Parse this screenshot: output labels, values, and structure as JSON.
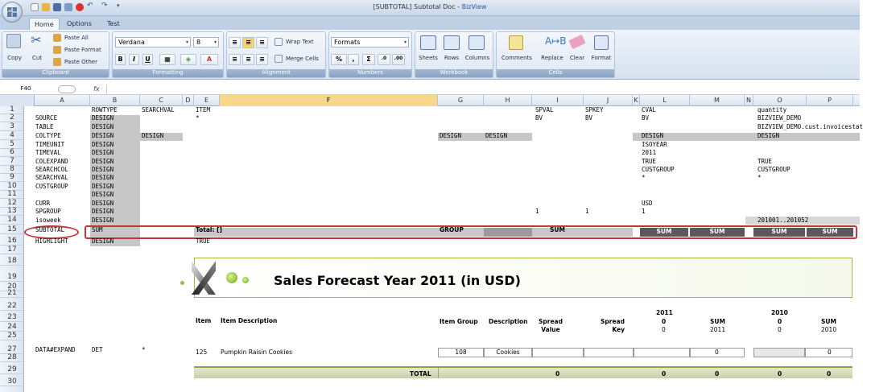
{
  "window": {
    "title_prefix": "[SUBTOTAL] Subtotal Doc - ",
    "app_name": "BizView"
  },
  "tabs": [
    {
      "label": "Home",
      "active": true
    },
    {
      "label": "Options"
    },
    {
      "label": "Test"
    }
  ],
  "ribbon": {
    "clipboard": {
      "label": "Clipboard",
      "copy": "Copy",
      "cut": "Cut",
      "paste_all": "Paste All",
      "paste_format": "Paste Format",
      "paste_other": "Paste Other"
    },
    "formatting": {
      "label": "Formatting",
      "font": "Verdana",
      "size": "8",
      "bold": "B",
      "italic": "I",
      "underline": "U"
    },
    "alignment": {
      "label": "Alignment",
      "wrap": "Wrap Text",
      "merge": "Merge Cells"
    },
    "numbers": {
      "label": "Numbers",
      "format": "Formats",
      "percent": "%",
      "comma": ",",
      "sum": "Σ"
    },
    "workbook": {
      "label": "Workbook",
      "sheets": "Sheets",
      "rows": "Rows",
      "columns": "Columns"
    },
    "cells": {
      "label": "Cells",
      "comments": "Comments",
      "replace": "Replace",
      "clear": "Clear",
      "format": "Format"
    }
  },
  "formula": {
    "namebox": "F40",
    "fx": "fx"
  },
  "columns": [
    "A",
    "B",
    "C",
    "D",
    "E",
    "F",
    "G",
    "H",
    "I",
    "J",
    "K",
    "L",
    "M",
    "N",
    "O",
    "P"
  ],
  "rows": [
    "1",
    "2",
    "3",
    "4",
    "5",
    "6",
    "7",
    "8",
    "9",
    "10",
    "11",
    "12",
    "13",
    "14",
    "15",
    "16",
    "17",
    "18",
    "19",
    "20",
    "21",
    "22",
    "23",
    "24",
    "25",
    "27",
    "28",
    "29",
    "30"
  ],
  "cells": {
    "b1": "ROWTYPE",
    "c1": "SEARCHVAL",
    "e1": "ITEM",
    "i1": "SPVAL",
    "j1": "SPKEY",
    "l1": "CVAL",
    "o1": "quantity",
    "a2": "SOURCE",
    "b2": "DESIGN",
    "e2": "*",
    "i2": "BV",
    "j2": "BV",
    "l2": "BV",
    "o2": "BIZVIEW_DEMO",
    "a3": "TABLE",
    "b3": "DESIGN",
    "o3": "BIZVIEW_DEMO.cust.invoicestat",
    "a4": "COLTYPE",
    "b4": "DESIGN",
    "c4": "DESIGN",
    "g4": "DESIGN",
    "h4": "DESIGN",
    "l4": "DESIGN",
    "o4": "DESIGN",
    "a5": "TIMEUNIT",
    "b5": "DESIGN",
    "l5": "ISOYEAR",
    "a6": "TIMEVAL",
    "b6": "DESIGN",
    "l6": "2011",
    "a7": "COLEXPAND",
    "b7": "DESIGN",
    "l7": "TRUE",
    "o7": "TRUE",
    "a8": "SEARCHCOL",
    "b8": "DESIGN",
    "l8": "CUSTGROUP",
    "o8": "CUSTGROUP",
    "a9": "SEARCHVAL",
    "b9": "DESIGN",
    "l9": "*",
    "o9": "*",
    "a10": "CUSTGROUP",
    "b10": "DESIGN",
    "b11": "DESIGN",
    "a12": "CURR",
    "b12": "DESIGN",
    "l12": "USD",
    "a13": "SPGROUP",
    "b13": "DESIGN",
    "i13": "1",
    "j13": "1",
    "l13": "1",
    "a14": "isoweek",
    "b14": "DESIGN",
    "o14": "201001..201052",
    "a15": "SUBTOTAL",
    "b15": "SUM",
    "e15": "Total: []",
    "g15": "GROUP",
    "i15": "SUM",
    "l15": "SUM",
    "m15": "SUM",
    "o15": "SUM",
    "p15": "SUM",
    "a16": "HIGHLIGHT",
    "b16": "DESIGN",
    "e16": "TRUE",
    "a27": "DATA#EXPAND",
    "b27": "DET",
    "c27": "*"
  },
  "report": {
    "title": "Sales Forecast Year 2011 (in USD)",
    "year_l": "2011",
    "year_o": "2010",
    "h_item": "Item",
    "h_desc": "Item Description",
    "h_group": "Item Group",
    "h_description": "Description",
    "h_spread_value": "Spread\nValue",
    "h_spread_key": "Spread\nKey",
    "h_l": "0",
    "h_l2": "0",
    "h_m": "SUM",
    "h_m2": "2011",
    "h_o": "0",
    "h_o2": "0",
    "h_p": "SUM",
    "h_p2": "2010",
    "item": "125",
    "item_desc": "Pumpkin Raisin Cookies",
    "item_group": "108",
    "item_description": "Cookies",
    "m_val": "0",
    "p_val": "0",
    "total": "TOTAL",
    "t_i": "0",
    "t_l": "0",
    "t_m": "0",
    "t_o": "0",
    "t_p": "0"
  }
}
